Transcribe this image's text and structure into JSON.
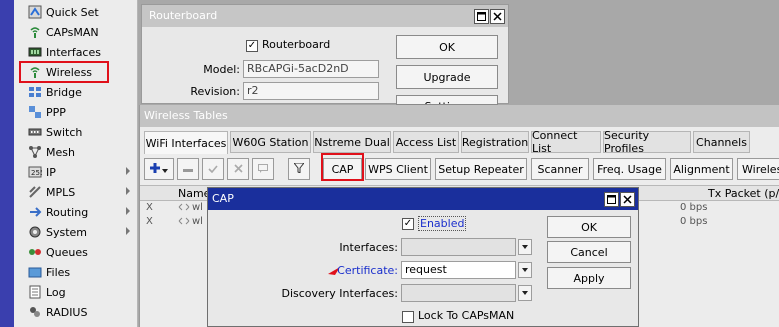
{
  "sidebar": {
    "items": [
      {
        "label": "Quick Set",
        "icon": "quick-set-icon"
      },
      {
        "label": "CAPsMAN",
        "icon": "capsman-icon"
      },
      {
        "label": "Interfaces",
        "icon": "interfaces-icon"
      },
      {
        "label": "Wireless",
        "icon": "wireless-icon"
      },
      {
        "label": "Bridge",
        "icon": "bridge-icon"
      },
      {
        "label": "PPP",
        "icon": "ppp-icon"
      },
      {
        "label": "Switch",
        "icon": "switch-icon"
      },
      {
        "label": "Mesh",
        "icon": "mesh-icon"
      },
      {
        "label": "IP",
        "icon": "ip-icon"
      },
      {
        "label": "MPLS",
        "icon": "mpls-icon"
      },
      {
        "label": "Routing",
        "icon": "routing-icon"
      },
      {
        "label": "System",
        "icon": "system-icon"
      },
      {
        "label": "Queues",
        "icon": "queues-icon"
      },
      {
        "label": "Files",
        "icon": "files-icon"
      },
      {
        "label": "Log",
        "icon": "log-icon"
      },
      {
        "label": "RADIUS",
        "icon": "radius-icon"
      }
    ]
  },
  "routerboard": {
    "title": "Routerboard",
    "checkbox_label": "Routerboard",
    "model_label": "Model:",
    "model_value": "RBcAPGi-5acD2nD",
    "revision_label": "Revision:",
    "revision_value": "r2",
    "ok_label": "OK",
    "upgrade_label": "Upgrade",
    "settings_label": "Settings"
  },
  "wireless_tables": {
    "title": "Wireless Tables",
    "tabs": [
      "WiFi Interfaces",
      "W60G Station",
      "Nstreme Dual",
      "Access List",
      "Registration",
      "Connect List",
      "Security Profiles",
      "Channels"
    ],
    "toolbar": {
      "cap": "CAP",
      "wps_client": "WPS Client",
      "setup_repeater": "Setup Repeater",
      "scanner": "Scanner",
      "freq_usage": "Freq. Usage",
      "alignment": "Alignment",
      "wireless": "Wireless"
    },
    "columns": {
      "name": "Name",
      "tx_packet": "Tx Packet (p/s"
    },
    "rows": [
      {
        "flag": "X",
        "name": "wl",
        "rate": "0 bps"
      },
      {
        "flag": "X",
        "name": "wl",
        "rate": "0 bps"
      }
    ]
  },
  "cap": {
    "title": "CAP",
    "enabled_label": "Enabled",
    "interfaces_label": "Interfaces:",
    "certificate_label": "Certificate:",
    "certificate_value": "request",
    "discovery_label": "Discovery Interfaces:",
    "lock_label": "Lock To CAPsMAN",
    "ok_label": "OK",
    "cancel_label": "Cancel",
    "apply_label": "Apply"
  },
  "colors": {
    "highlight": "#e0101a",
    "dialog_title": "#1a2f9c",
    "link": "#1a2fcc"
  }
}
